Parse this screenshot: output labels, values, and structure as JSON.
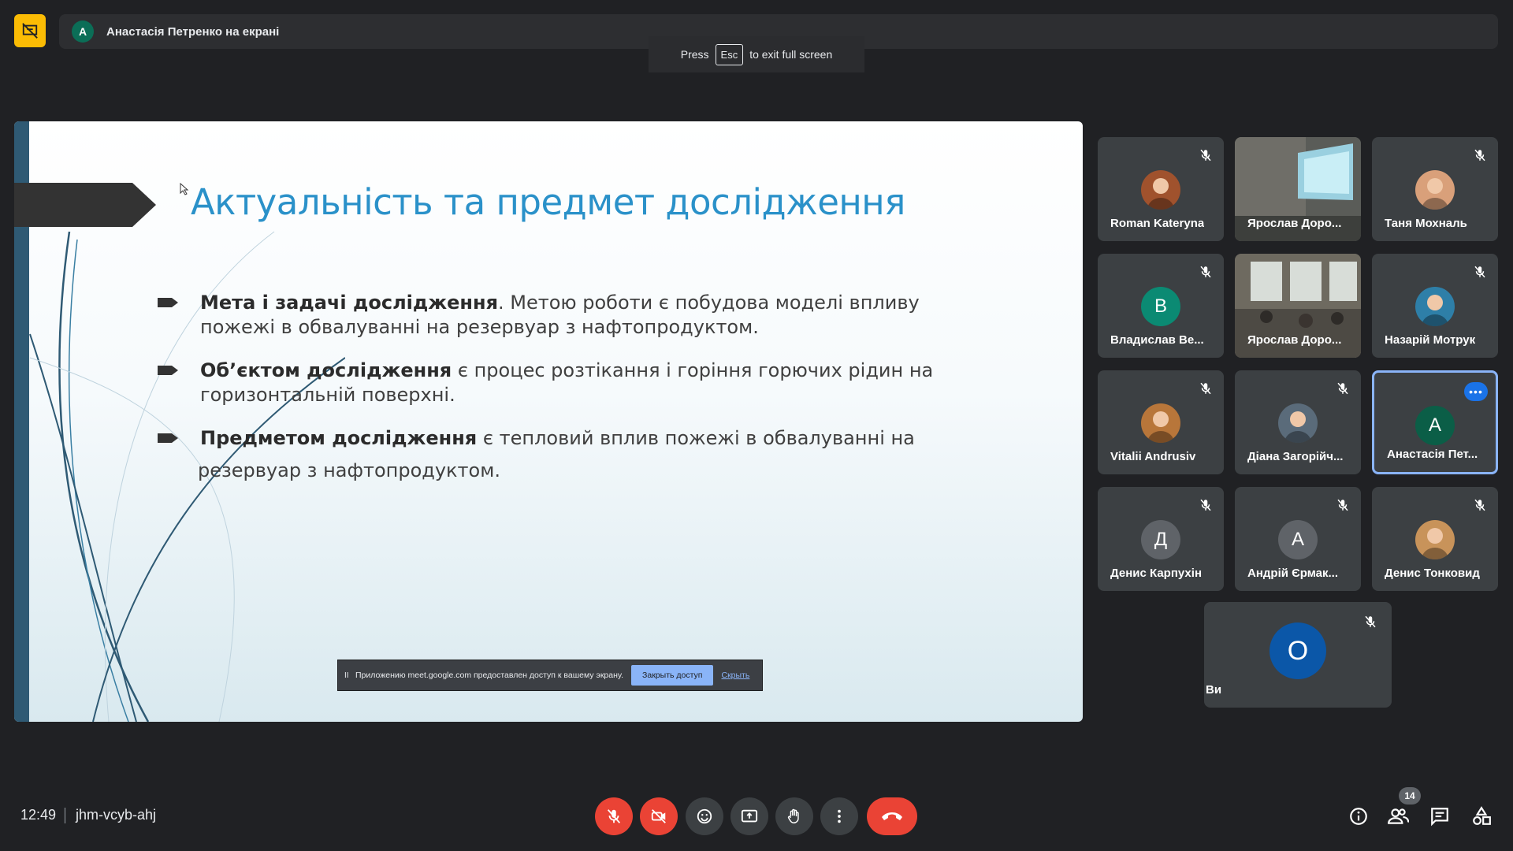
{
  "top": {
    "presenter_initial": "А",
    "presenter_label": "Анастасія Петренко на екрані",
    "esc_press": "Press",
    "esc_key": "Esc",
    "esc_suffix": "to exit full screen"
  },
  "slide": {
    "title": "Актуальність та предмет дослідження",
    "bullets": [
      {
        "bold": "Мета і задачі дослідження",
        "text": ". Метою роботи є побудова моделі впливу пожежі в обвалуванні на резервуар з нафтопродуктом."
      },
      {
        "bold": "Об’єктом дослідження",
        "text": " є процес розтікання і горіння горючих рідин на горизонтальній поверхні."
      },
      {
        "bold": "Предметом дослідження",
        "text": " є тепловий вплив пожежі в обвалуванні на",
        "continuation": "резервуар з нафтопродуктом."
      }
    ],
    "share_notice": {
      "pause": "II",
      "text": "Приложению meet.google.com предоставлен доступ к вашему экрану.",
      "stop_label": "Закрыть доступ",
      "hide_label": "Скрыть"
    }
  },
  "participants": [
    {
      "name": "Roman Kateryna",
      "type": "photo",
      "color": "#a0522d"
    },
    {
      "name": "Ярослав Доро...",
      "type": "video"
    },
    {
      "name": "Таня Мохналь",
      "type": "photo",
      "color": "#d9a07a"
    },
    {
      "name": "Владислав Ве...",
      "type": "initial",
      "initial": "В",
      "color": "#0b8a73"
    },
    {
      "name": "Ярослав Доро...",
      "type": "video2"
    },
    {
      "name": "Назарій Мотрук",
      "type": "photo",
      "color": "#2e7fa8"
    },
    {
      "name": "Vitalii Andrusiv",
      "type": "photo",
      "color": "#b8763a"
    },
    {
      "name": "Діана Загорійч...",
      "type": "photo",
      "color": "#5a6b7a"
    },
    {
      "name": "Анастасія Пет...",
      "type": "initial",
      "initial": "А",
      "color": "#0b5e47",
      "active": true
    },
    {
      "name": "Денис Карпухін",
      "type": "initial",
      "initial": "Д",
      "color": "#5f6368"
    },
    {
      "name": "Андрій Єрмак...",
      "type": "initial",
      "initial": "А",
      "color": "#5f6368"
    },
    {
      "name": "Денис Тонковид",
      "type": "photo",
      "color": "#c8935a"
    },
    {
      "name": "Ви",
      "type": "initial",
      "initial": "О",
      "color": "#0b57a8"
    }
  ],
  "bottom": {
    "time": "12:49",
    "meeting_code": "jhm-vcyb-ahj",
    "people_count": "14"
  },
  "colors": {
    "background": "#202124",
    "tile": "#3c4043",
    "danger": "#ea4335",
    "accent": "#8ab4f8",
    "pin": "#fbbc04"
  }
}
